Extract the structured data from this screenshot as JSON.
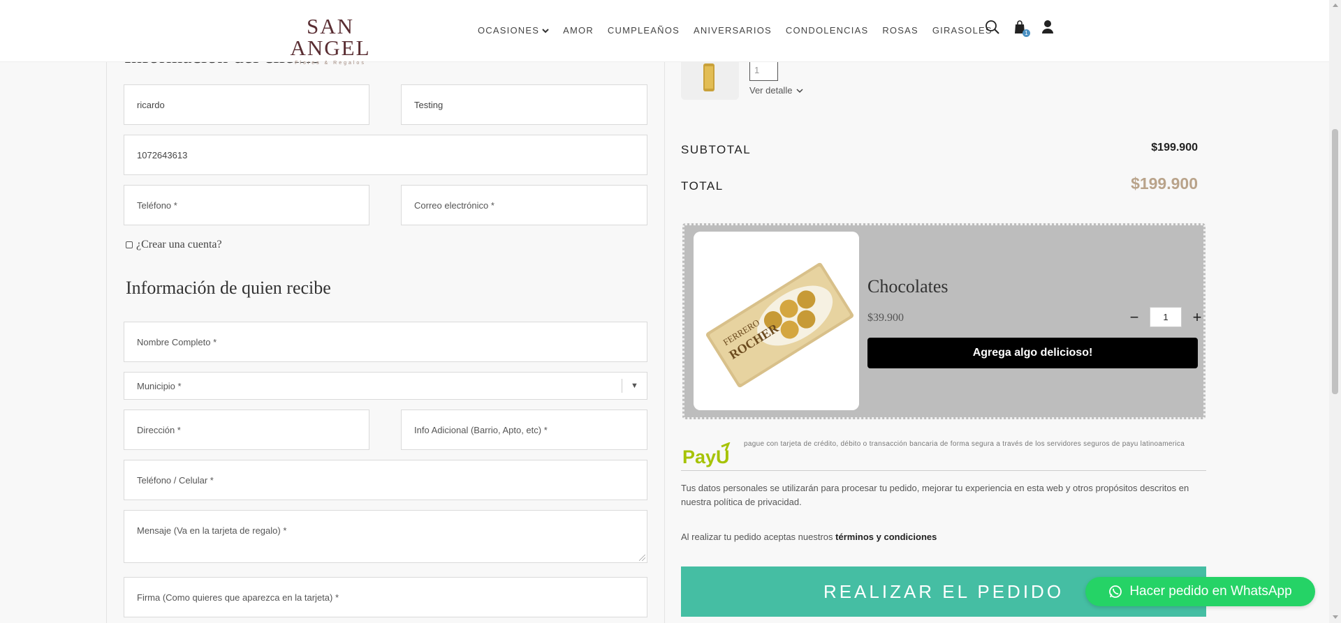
{
  "header": {
    "logo_main": "SAN ANGEL",
    "logo_sub": "Flores & Regalos",
    "nav": [
      {
        "label": "OCASIONES",
        "dropdown": true
      },
      {
        "label": "AMOR"
      },
      {
        "label": "CUMPLEAÑOS"
      },
      {
        "label": "ANIVERSARIOS"
      },
      {
        "label": "CONDOLENCIAS"
      },
      {
        "label": "ROSAS"
      },
      {
        "label": "GIRASOLES"
      }
    ],
    "cart_count": "1"
  },
  "customer": {
    "section_title": "Información del cliente",
    "first_name": "ricardo",
    "last_name": "Testing",
    "document": "1072643613",
    "phone_placeholder": "Teléfono *",
    "email_placeholder": "Correo electrónico *",
    "create_account_label": "¿Crear una cuenta?"
  },
  "recipient": {
    "section_title": "Información de quien recibe",
    "full_name_placeholder": "Nombre Completo *",
    "municipio_placeholder": "Municipio *",
    "address_placeholder": "Dirección *",
    "extra_info_placeholder": "Info Adicional (Barrio, Apto, etc) *",
    "phone_placeholder": "Teléfono / Celular *",
    "message_placeholder": "Mensaje (Va en la tarjeta de regalo) *",
    "signature_placeholder": "Firma (Como quieres que aparezca en la tarjeta) *"
  },
  "order": {
    "item_qty": "1",
    "ver_detalle": "Ver detalle",
    "subtotal_label": "SUBTOTAL",
    "subtotal_value": "$199.900",
    "total_label": "TOTAL",
    "total_value": "$199.900"
  },
  "upsell": {
    "title": "Chocolates",
    "price": "$39.900",
    "qty": "1",
    "button_label": "Agrega algo delicioso!",
    "box_text_brand": "FERRERO",
    "box_text_product": "ROCHER"
  },
  "payment": {
    "payu_logo_text": "PayU",
    "payu_description": "pague con tarjeta de crédito, débito o transacción bancaria de forma segura a través de los servidores seguros de payu latinoamerica",
    "privacy_text": "Tus datos personales se utilizarán para procesar tu pedido, mejorar tu experiencia en esta web y otros propósitos descritos en nuestra política de privacidad.",
    "terms_prefix": "Al realizar tu pedido aceptas nuestros ",
    "terms_link": "términos y condiciones",
    "place_order_label": "REALIZAR EL PEDIDO"
  },
  "whatsapp": {
    "label": "Hacer pedido en WhatsApp"
  },
  "colors": {
    "place_order_bg": "#45bea3",
    "whatsapp_bg": "#25d366",
    "total_color": "#b9a38a",
    "logo_color": "#5a2e33"
  }
}
